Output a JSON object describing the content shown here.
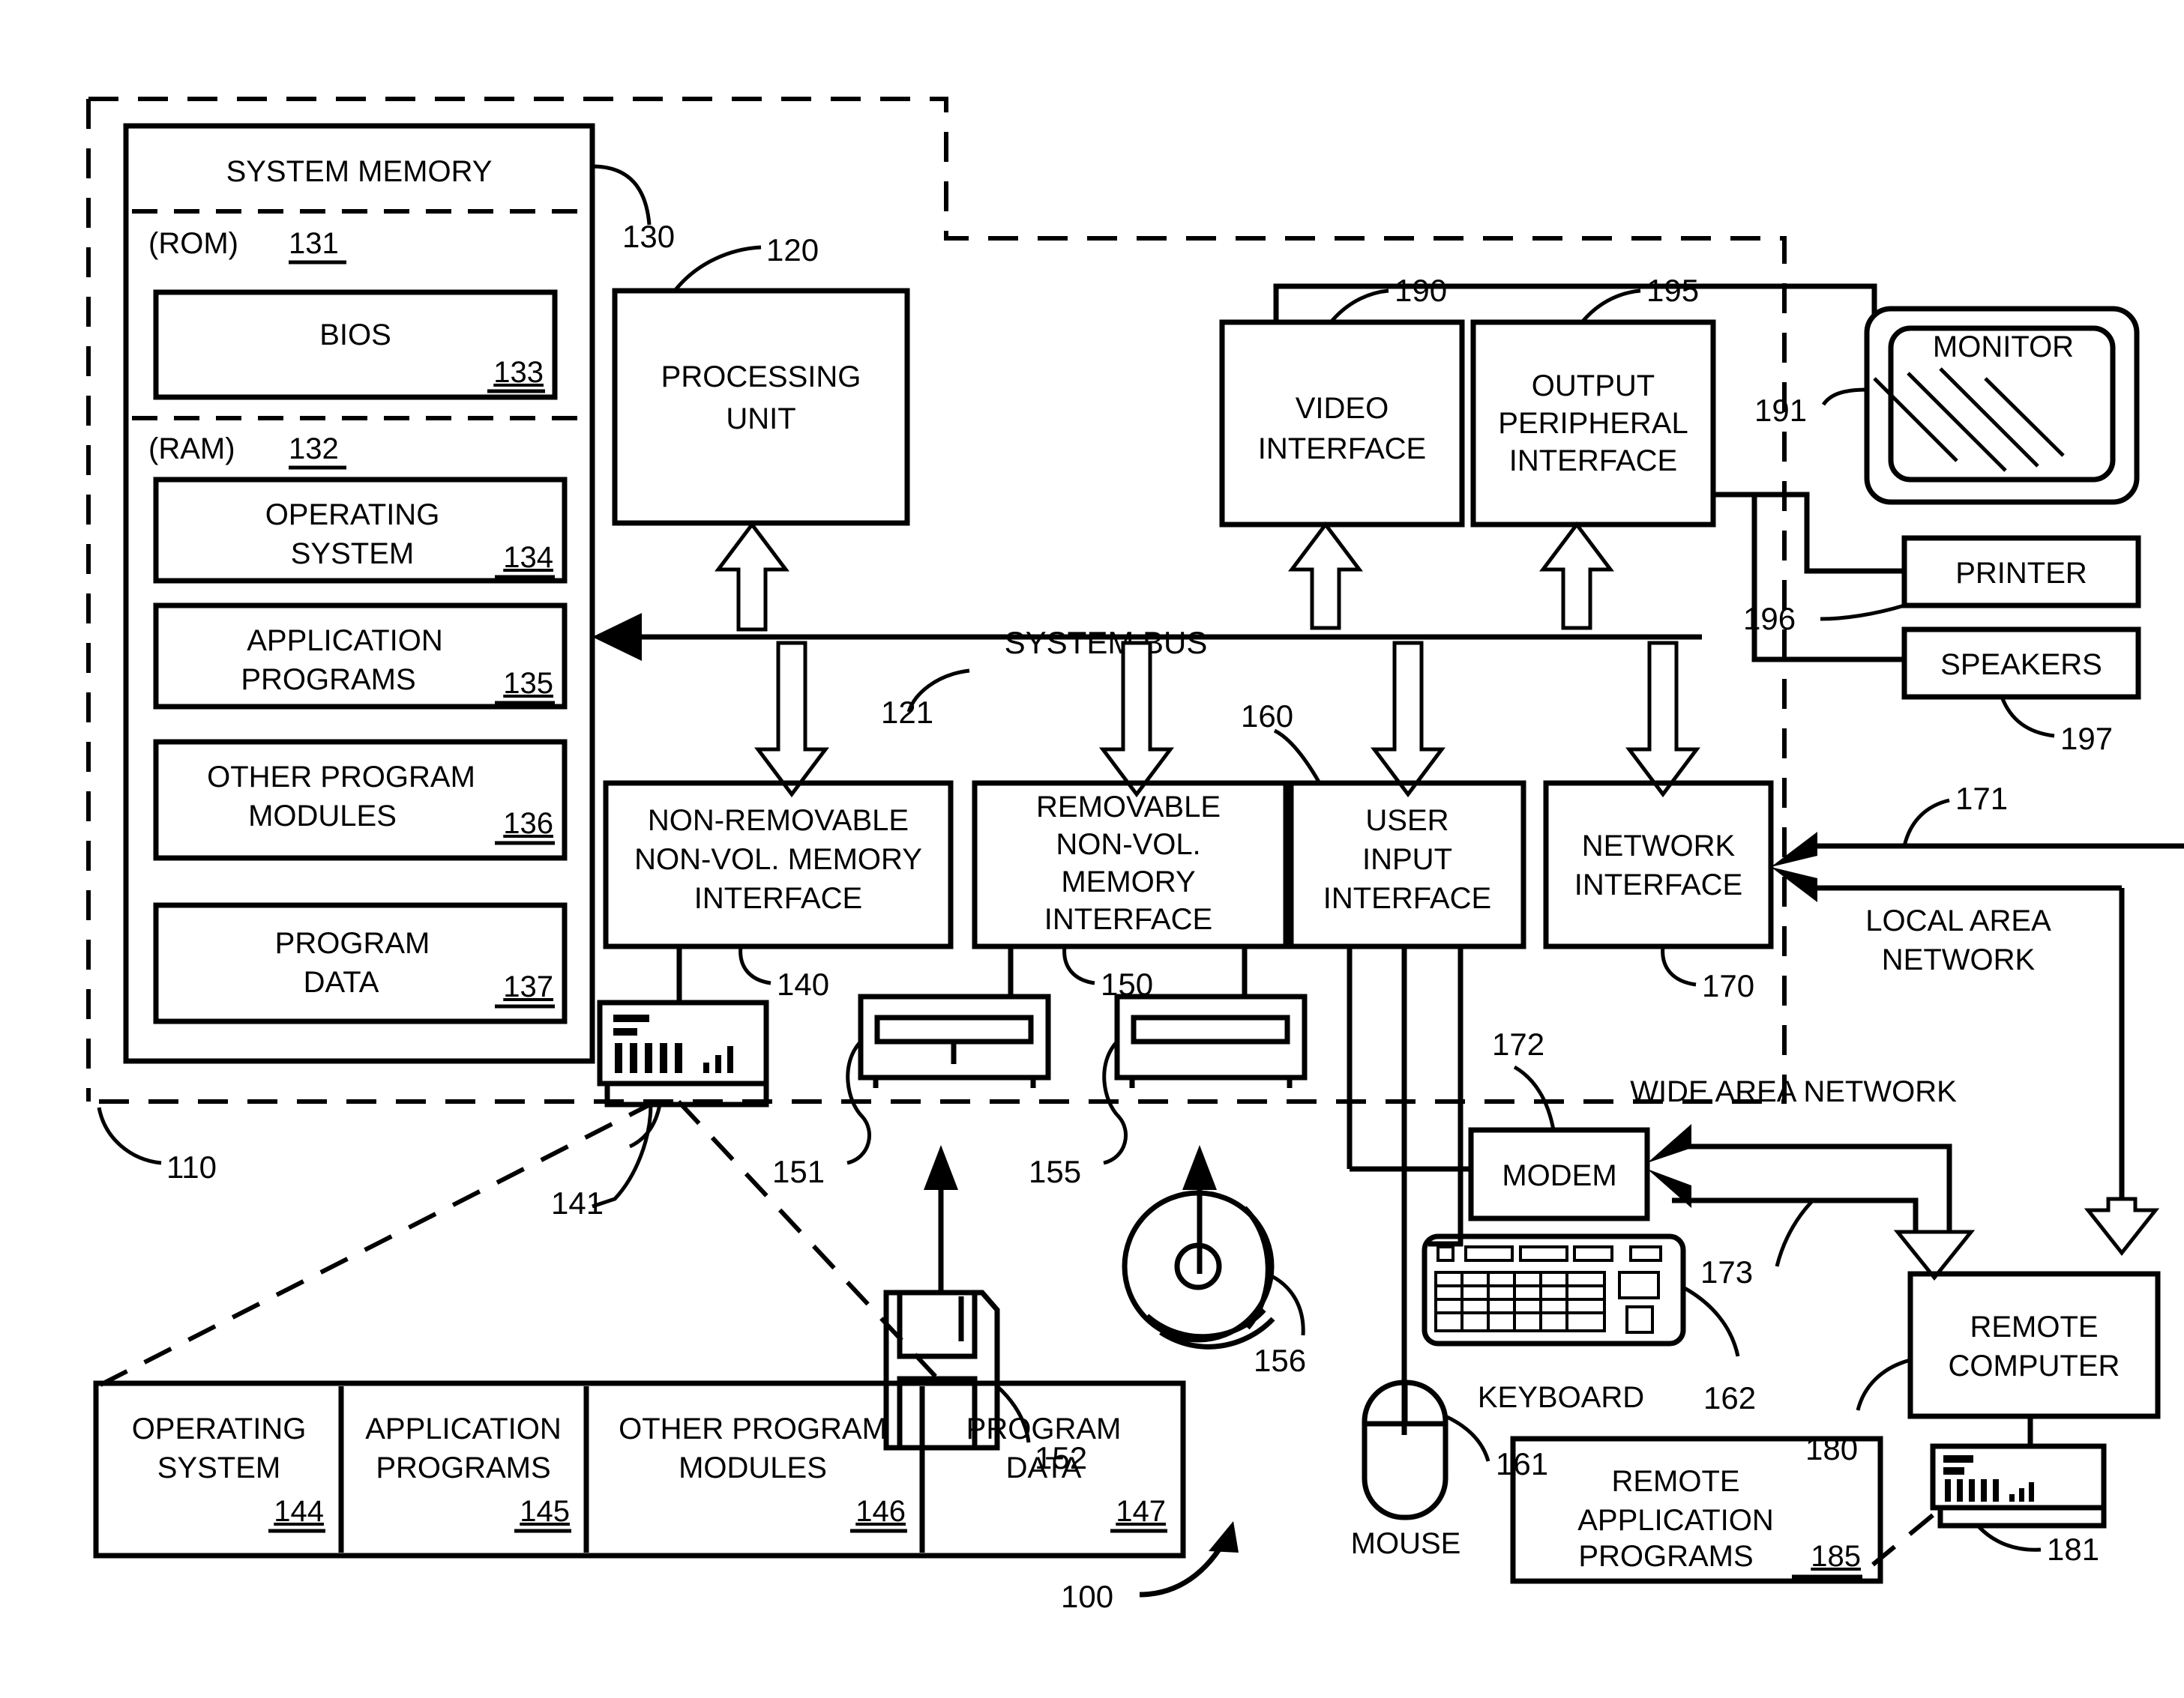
{
  "figure": {
    "overall_ref": "100",
    "computer_ref": "110"
  },
  "system_memory": {
    "title": "SYSTEM MEMORY",
    "ref": "130",
    "rom_label": "(ROM)",
    "rom_ref": "131",
    "bios_label": "BIOS",
    "bios_ref": "133",
    "ram_label": "(RAM)",
    "ram_ref": "132",
    "items": [
      {
        "line1": "OPERATING",
        "line2": "SYSTEM",
        "ref": "134"
      },
      {
        "line1": "APPLICATION",
        "line2": "PROGRAMS",
        "ref": "135"
      },
      {
        "line1": "OTHER PROGRAM",
        "line2": "MODULES",
        "ref": "136"
      },
      {
        "line1": "PROGRAM",
        "line2": "DATA",
        "ref": "137"
      }
    ]
  },
  "processing_unit": {
    "line1": "PROCESSING",
    "line2": "UNIT",
    "ref": "120"
  },
  "system_bus": {
    "label": "SYSTEM BUS",
    "ref": "121"
  },
  "interfaces": {
    "non_removable": {
      "line1": "NON-REMOVABLE",
      "line2": "NON-VOL. MEMORY",
      "line3": "INTERFACE",
      "ref": "140"
    },
    "removable": {
      "line1": "REMOVABLE",
      "line2": "NON-VOL.",
      "line3": "MEMORY",
      "line4": "INTERFACE",
      "ref": "150"
    },
    "user_input": {
      "line1": "USER",
      "line2": "INPUT",
      "line3": "INTERFACE",
      "ref": "160"
    },
    "network": {
      "line1": "NETWORK",
      "line2": "INTERFACE",
      "ref": "170"
    },
    "video": {
      "line1": "VIDEO",
      "line2": "INTERFACE",
      "ref": "190"
    },
    "output_peripheral": {
      "line1": "OUTPUT",
      "line2": "PERIPHERAL",
      "line3": "INTERFACE",
      "ref": "195"
    }
  },
  "output_devices": {
    "monitor": {
      "label": "MONITOR",
      "ref": "191"
    },
    "printer": {
      "label": "PRINTER",
      "ref": "196"
    },
    "speakers": {
      "label": "SPEAKERS",
      "ref": "197"
    }
  },
  "storage_devices": {
    "hard_drive_ref": "141",
    "hard_drive_media_ref": "151",
    "floppy_drive_ref": "155",
    "floppy_disk_ref": "152",
    "optical_disc_ref": "156"
  },
  "input_devices": {
    "mouse": {
      "label": "MOUSE",
      "ref": "161"
    },
    "keyboard": {
      "label": "KEYBOARD",
      "ref": "162"
    }
  },
  "network": {
    "local_area_network": {
      "line1": "LOCAL AREA",
      "line2": "NETWORK",
      "ref": "171"
    },
    "wide_area_network": {
      "label": "WIDE AREA NETWORK",
      "ref": "173"
    },
    "modem": {
      "label": "MODEM",
      "ref": "172"
    },
    "remote_computer": {
      "line1": "REMOTE",
      "line2": "COMPUTER",
      "ref": "180"
    },
    "remote_storage_ref": "181",
    "remote_application_programs": {
      "line1": "REMOTE",
      "line2": "APPLICATION",
      "line3": "PROGRAMS",
      "ref": "185"
    }
  },
  "storage_table": {
    "columns": [
      {
        "line1": "OPERATING",
        "line2": "SYSTEM",
        "ref": "144"
      },
      {
        "line1": "APPLICATION",
        "line2": "PROGRAMS",
        "ref": "145"
      },
      {
        "line1": "OTHER PROGRAM",
        "line2": "MODULES",
        "ref": "146"
      },
      {
        "line1": "PROGRAM",
        "line2": "DATA",
        "ref": "147"
      }
    ]
  }
}
